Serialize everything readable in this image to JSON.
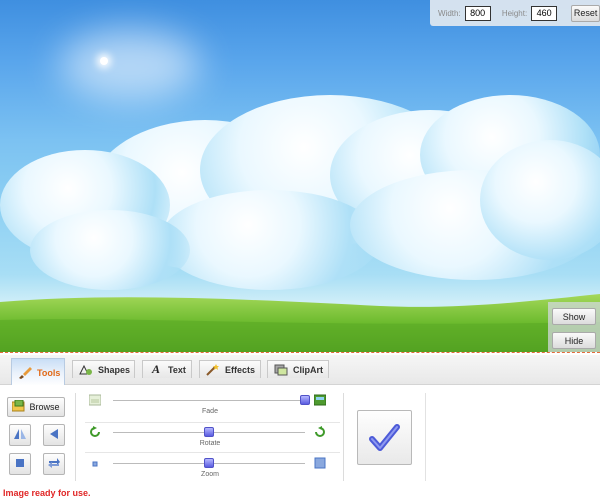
{
  "size_panel": {
    "width_label": "Width:",
    "width_value": "800",
    "height_label": "Height:",
    "height_value": "460",
    "reset_label": "Reset"
  },
  "side_buttons": {
    "show_label": "Show",
    "hide_label": "Hide"
  },
  "tabs": [
    {
      "label": "Tools",
      "icon": "brush-icon",
      "active": true
    },
    {
      "label": "Shapes",
      "icon": "shapes-icon",
      "active": false
    },
    {
      "label": "Text",
      "icon": "text-a-icon",
      "active": false
    },
    {
      "label": "Effects",
      "icon": "magic-wand-icon",
      "active": false
    },
    {
      "label": "ClipArt",
      "icon": "clipart-icon",
      "active": false
    }
  ],
  "tools": {
    "browse_label": "Browse",
    "sliders": [
      {
        "label": "Fade",
        "value": 1.0
      },
      {
        "label": "Rotate",
        "value": 0.5
      },
      {
        "label": "Zoom",
        "value": 0.5
      }
    ]
  },
  "status": {
    "message": "Image ready for use.",
    "color": "#e02626"
  },
  "colors": {
    "accent_tab": "#e26a18",
    "slider_thumb": "#5a5ce0",
    "sky": "#5aa6ec",
    "grass": "#6cbb2e"
  }
}
